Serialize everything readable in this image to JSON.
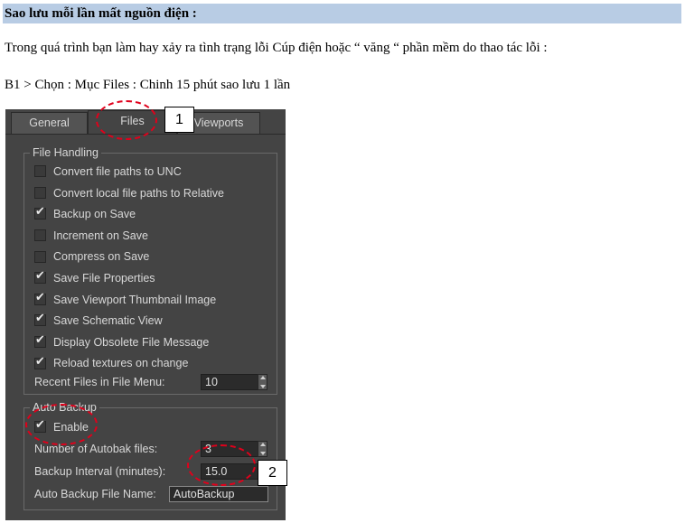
{
  "heading": "Sao lưu mỗi lần mất nguồn điện :",
  "paragraph1": "Trong quá trình bạn làm hay xảy ra tình trạng lỗi Cúp điện hoặc “ văng “ phần mềm do thao tác lỗi :",
  "paragraph2": "B1 > Chọn : Mục Files  : Chinh 15 phút sao lưu 1 lần",
  "tabs": [
    "General",
    "Files",
    "Viewports"
  ],
  "file_handling": {
    "title": "File Handling",
    "options": [
      {
        "label": "Convert file paths to UNC",
        "checked": false
      },
      {
        "label": "Convert local file paths to Relative",
        "checked": false
      },
      {
        "label": "Backup on Save",
        "checked": true
      },
      {
        "label": "Increment on Save",
        "checked": false
      },
      {
        "label": "Compress on Save",
        "checked": false
      },
      {
        "label": "Save File Properties",
        "checked": true
      },
      {
        "label": "Save Viewport Thumbnail Image",
        "checked": true
      },
      {
        "label": "Save Schematic View",
        "checked": true
      },
      {
        "label": "Display Obsolete File Message",
        "checked": true
      },
      {
        "label": "Reload textures on change",
        "checked": true
      }
    ],
    "recent_files_label": "Recent Files in File Menu:",
    "recent_files_value": "10"
  },
  "auto_backup": {
    "title": "Auto Backup",
    "enable_label": "Enable",
    "enable_checked": true,
    "num_files_label": "Number of Autobak files:",
    "num_files_value": "3",
    "interval_label": "Backup Interval (minutes):",
    "interval_value": "15.0",
    "file_name_label": "Auto Backup File Name:",
    "file_name_value": "AutoBackup"
  },
  "callouts": [
    "1",
    "2"
  ],
  "check_glyph": "✔",
  "colors": {
    "annotation": "#e0001b",
    "heading_bg": "#b8cce4",
    "dialog_bg": "#444444"
  }
}
